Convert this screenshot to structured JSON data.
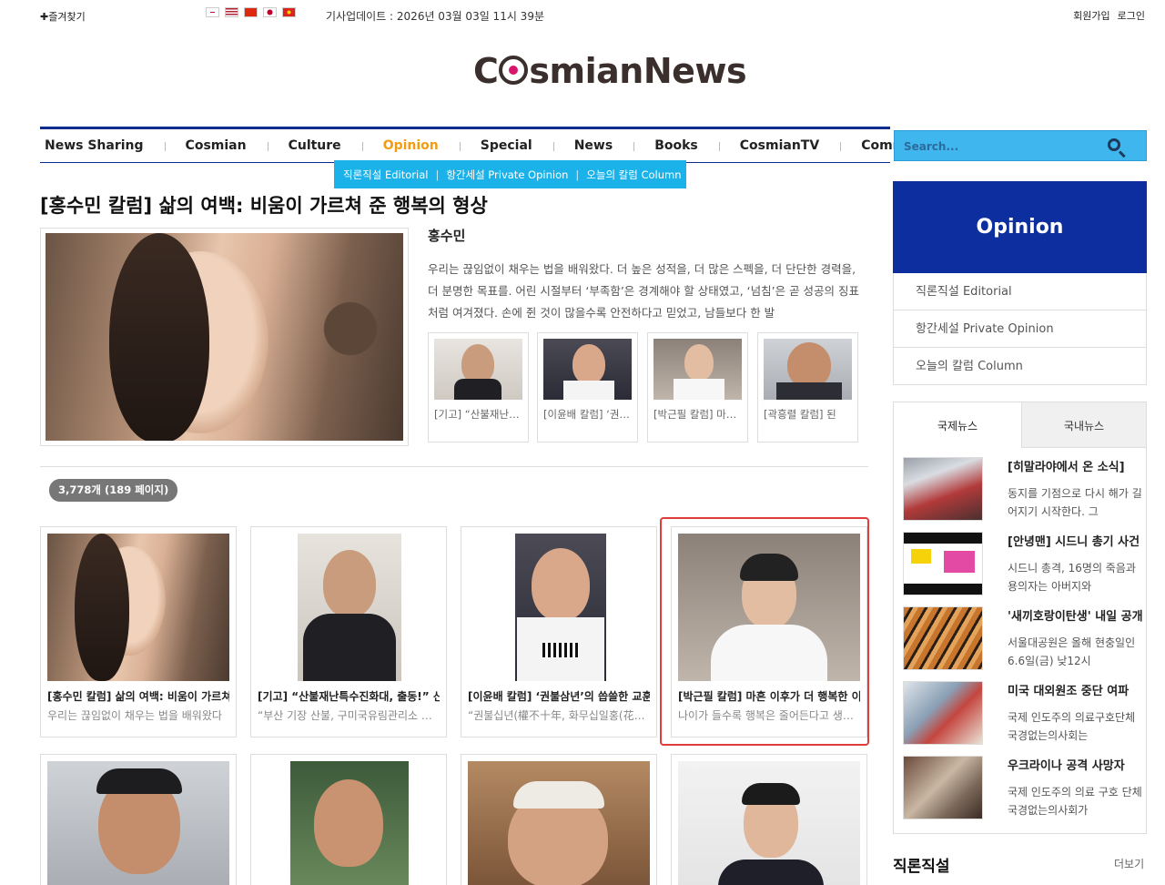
{
  "topbar": {
    "bookmark": "✚즐겨찾기",
    "update_text": "기사업데이트 : 2026년 03월 03일 11시 39분",
    "signup": "회원가입",
    "login": "로그인"
  },
  "logo": {
    "text_a": "C",
    "text_b": "smianNews"
  },
  "nav": [
    {
      "label": "News Sharing"
    },
    {
      "label": "Cosmian"
    },
    {
      "label": "Culture"
    },
    {
      "label": "Opinion"
    },
    {
      "label": "Special"
    },
    {
      "label": "News"
    },
    {
      "label": "Books"
    },
    {
      "label": "CosmianTV"
    },
    {
      "label": "Community"
    }
  ],
  "subnav": [
    "직론직설 Editorial",
    "항간세설 Private Opinion",
    "오늘의 칼럼 Column"
  ],
  "search": {
    "placeholder": "Search..."
  },
  "featured": {
    "headline": "[홍수민 칼럼] 삶의 여백: 비움이 가르쳐 준 행복의 형상",
    "author": "홍수민",
    "summary": "우리는 끊임없이 채우는 법을 배워왔다. 더 높은 성적을, 더 많은 스펙을, 더 단단한 경력을, 더 분명한 목표를. 어린 시절부터 ‘부족함’은 경계해야 할 상태였고, ‘넘침’은 곧 성공의 징표처럼 여겨졌다. 손에 쥔 것이 많을수록 안전하다고 믿었고, 남들보다 한 발"
  },
  "related": [
    {
      "title": "[기고] “산불재난특수진화대, 출동!”"
    },
    {
      "title": "[이윤배 칼럼] ‘권불삼년’의 씁쓸한 교훈"
    },
    {
      "title": "[박근필 칼럼] 마흔 이후가 더 행복한"
    },
    {
      "title": "[곽흥렬 칼럼] 된"
    }
  ],
  "count_badge": "3,778개 (189 페이지)",
  "cards": [
    {
      "title": "[홍수민 칼럼] 삶의 여백: 비움이 가르쳐 준",
      "summary": "우리는 끊임없이 채우는 법을 배워왔다"
    },
    {
      "title": "[기고] “산불재난특수진화대, 출동!” 산",
      "summary": "“부산 기장 산불, 구미국유림관리소 산불재난특수진화대"
    },
    {
      "title": "[이윤배 칼럼] ‘권불삼년’의 씁쓸한 교훈",
      "summary": "“권불십년(權不十年, 화무십일홍(花無十日紅)"
    },
    {
      "title": "[박근필 칼럼] 마흔 이후가 더 행복한 이유",
      "summary": "나이가 들수록 행복은 줄어든다고 생각하기 쉽다"
    }
  ],
  "sidebar": {
    "opinion_title": "Opinion",
    "opinion_items": [
      "직론직설 Editorial",
      "항간세설 Private Opinion",
      "오늘의 칼럼 Column"
    ],
    "tabs": [
      "국제뉴스",
      "국내뉴스"
    ],
    "news": [
      {
        "title": "[히말라야에서 온 소식]",
        "summary": "동지를 기점으로 다시 해가 길어지기 시작한다. 그"
      },
      {
        "title": "[안녕맨] 시드니 총기 사건",
        "summary": "시드니 총격, 16명의 죽음과 용의자는 아버지와"
      },
      {
        "title": "'새끼호랑이탄생' 내일 공개",
        "summary": "서울대공원은 올해 현충일인 6.6일(금) 낮12시"
      },
      {
        "title": "미국 대외원조 중단 여파",
        "summary": "국제 인도주의 의료구호단체 국경없는의사회는"
      },
      {
        "title": "우크라이나 공격 사망자",
        "summary": "국제 인도주의 의료 구호 단체 국경없는의사회가"
      }
    ],
    "editorial_title": "직론직설",
    "more": "더보기"
  }
}
